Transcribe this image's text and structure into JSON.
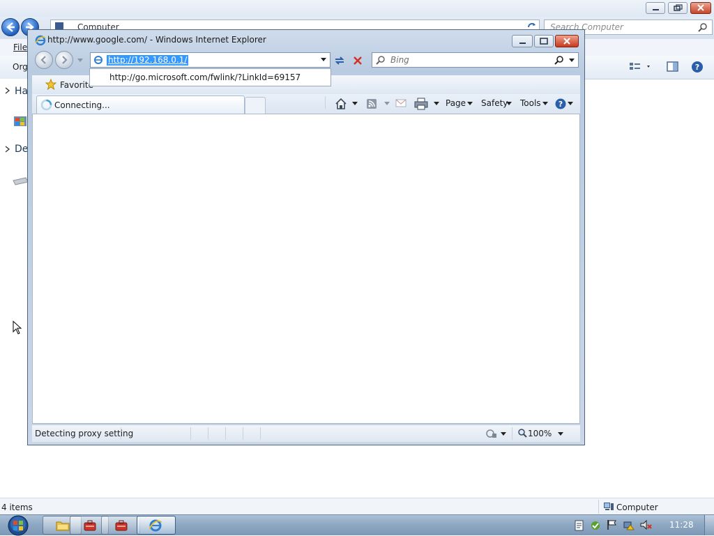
{
  "explorer": {
    "breadcrumb": "Computer",
    "search_placeholder": "Search Computer",
    "menu": {
      "file": "File"
    },
    "commandbar": {
      "organize": "Org"
    },
    "navpane": {
      "item1": "Ha",
      "item2": "De"
    },
    "status": {
      "items_count": "4 items",
      "location_label": "Computer"
    }
  },
  "ie": {
    "title": "http://www.google.com/ - Windows Internet Explorer",
    "address_value": "http://192.168.0.1/",
    "search_placeholder": "Bing",
    "autocomplete_item": "http://go.microsoft.com/fwlink/?LinkId=69157",
    "favorites_label": "Favorite",
    "tab_title": "Connecting...",
    "commandbar": {
      "page": "Page",
      "safety": "Safety",
      "tools": "Tools"
    },
    "status_text": "Detecting proxy setting",
    "zoom": "100%"
  },
  "taskbar": {
    "clock": "11:28",
    "buttons": [
      "windows-explorer",
      "app-red-1",
      "app-red-2",
      "internet-explorer"
    ]
  },
  "colors": {
    "selection": "#3399ff",
    "close_button": "#c8452a",
    "taskbar": "#8fa9c4"
  }
}
